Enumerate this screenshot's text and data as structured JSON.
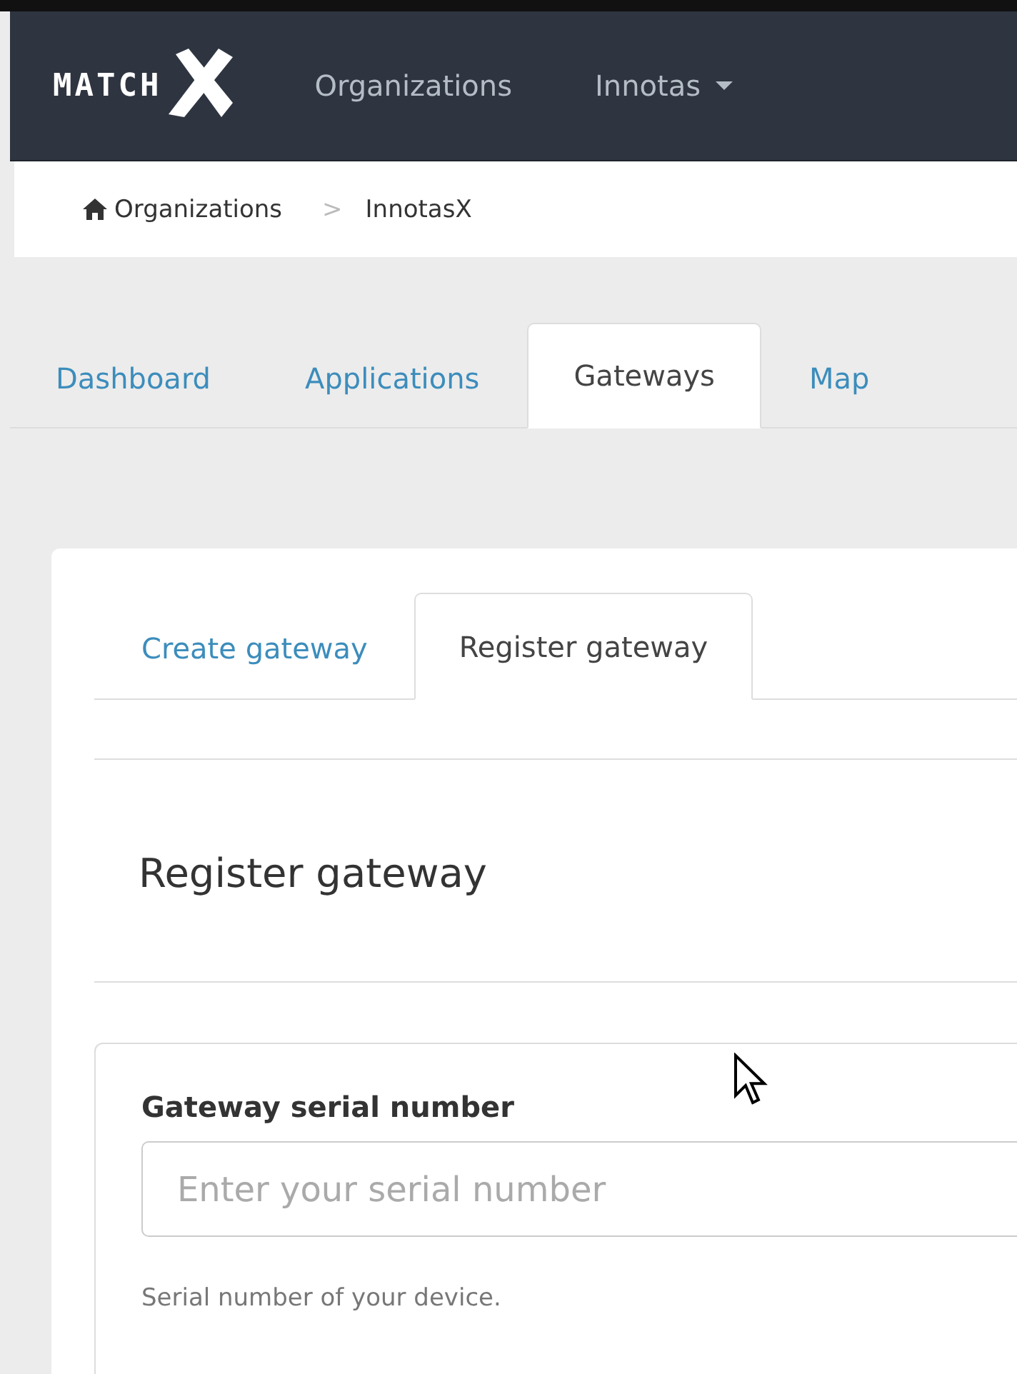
{
  "navbar": {
    "logo_text": "MATCH",
    "items": [
      {
        "label": "Organizations",
        "dropdown": false
      },
      {
        "label": "Innotas",
        "dropdown": true
      }
    ]
  },
  "breadcrumb": [
    {
      "label": "Organizations",
      "home": true
    },
    {
      "label": "InnotasX",
      "home": false
    }
  ],
  "breadcrumb_separator": ">",
  "tabs": [
    {
      "label": "Dashboard",
      "selected": false
    },
    {
      "label": "Applications",
      "selected": false
    },
    {
      "label": "Gateways",
      "selected": true
    },
    {
      "label": "Map",
      "selected": false
    }
  ],
  "card": {
    "tabs": [
      {
        "label": "Create gateway",
        "selected": false
      },
      {
        "label": "Register gateway",
        "selected": true
      }
    ],
    "heading": "Register gateway",
    "form": {
      "label": "Gateway serial number",
      "placeholder": "Enter your serial number",
      "help": "Serial number of your device."
    }
  }
}
